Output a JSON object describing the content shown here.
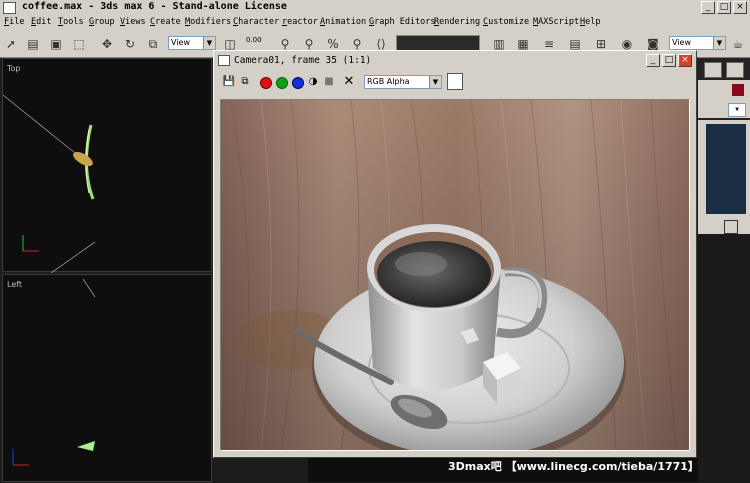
{
  "window": {
    "title": "coffee.max - 3ds max 6 - Stand-alone License",
    "minimize": "_",
    "maximize": "□",
    "close": "×"
  },
  "menu": [
    "File",
    "Edit",
    "Tools",
    "Group",
    "Views",
    "Create",
    "Modifiers",
    "Character",
    "reactor",
    "Animation",
    "Graph Editors",
    "Rendering",
    "Customize",
    "MAXScript",
    "Help"
  ],
  "toolbar": {
    "view_dropdown_left": "View",
    "view_dropdown_right": "View",
    "spinner_value": "0.00"
  },
  "viewports": {
    "top_label": "Top",
    "left_label": "Left"
  },
  "render_window": {
    "title": "Camera01, frame 35 (1:1)",
    "channel": "RGB Alpha",
    "colors": {
      "red": "#e01010",
      "green": "#10a010",
      "blue": "#1030e0"
    }
  },
  "watermark": "3Dmax吧 【www.linecg.com/tieba/1771】"
}
